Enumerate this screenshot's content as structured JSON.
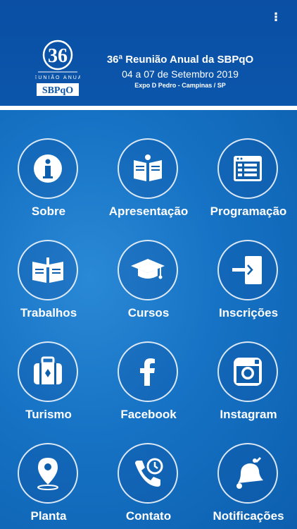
{
  "header": {
    "menu_icon": "⁝",
    "logo_text": "36",
    "logo_sub": "REUNIÃO ANUAL",
    "logo_brand": "SBPqO",
    "title": "36ª Reunião Anual da SBPqO",
    "dates": "04 a 07 de Setembro 2019",
    "place": "Expo D Pedro - Campinas / SP"
  },
  "tiles": [
    {
      "label": "Sobre",
      "icon": "info-icon"
    },
    {
      "label": "Apresentação",
      "icon": "book-icon"
    },
    {
      "label": "Programação",
      "icon": "calendar-icon"
    },
    {
      "label": "Trabalhos",
      "icon": "open-book-icon"
    },
    {
      "label": "Cursos",
      "icon": "graduation-cap-icon"
    },
    {
      "label": "Inscrições",
      "icon": "sign-in-icon"
    },
    {
      "label": "Turismo",
      "icon": "suitcase-icon"
    },
    {
      "label": "Facebook",
      "icon": "facebook-icon"
    },
    {
      "label": "Instagram",
      "icon": "instagram-icon"
    },
    {
      "label": "Planta",
      "icon": "map-pin-icon"
    },
    {
      "label": "Contato",
      "icon": "phone-icon"
    },
    {
      "label": "Notificações",
      "icon": "bell-icon"
    }
  ]
}
